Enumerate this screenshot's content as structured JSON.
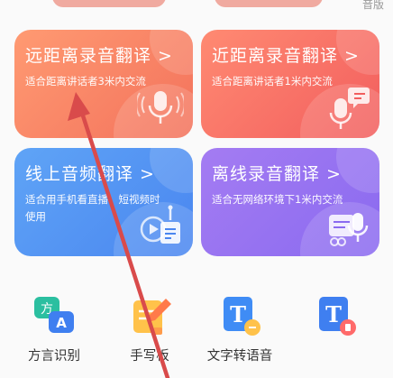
{
  "top_right_text": "音版",
  "cards": [
    {
      "id": "far",
      "title": "远距离录音翻译 >",
      "desc": "适合距离讲话者3米内交流",
      "icon": "microphone-waves-icon"
    },
    {
      "id": "near",
      "title": "近距离录音翻译 >",
      "desc": "适合距离讲话者1米内交流",
      "icon": "microphone-chat-icon"
    },
    {
      "id": "online",
      "title": "线上音频翻译 >",
      "desc": "适合用手机看直播、短视频时使用",
      "icon": "video-audio-icon"
    },
    {
      "id": "offline",
      "title": "离线录音翻译 >",
      "desc": "适合无网络环境下1米内交流",
      "icon": "offline-mic-icon"
    }
  ],
  "tools": [
    {
      "id": "dialect",
      "label": "方言识别",
      "icon": "dialect-icon"
    },
    {
      "id": "handwrite",
      "label": "手写板",
      "icon": "handwriting-pad-icon"
    },
    {
      "id": "tts",
      "label": "文字转语音",
      "icon": "text-to-speech-icon"
    },
    {
      "id": "fourth",
      "label": "",
      "icon": "text-document-icon"
    }
  ],
  "icon_text": {
    "dialect_glyph": "方",
    "dialect_letter": "A",
    "tts_letter": "T",
    "fourth_letter": "T"
  },
  "colors": {
    "card_far": "#f3725c",
    "card_near": "#f25e5e",
    "card_online": "#4a86f0",
    "card_offline": "#8a6af0",
    "arrow": "#d94b4b"
  }
}
